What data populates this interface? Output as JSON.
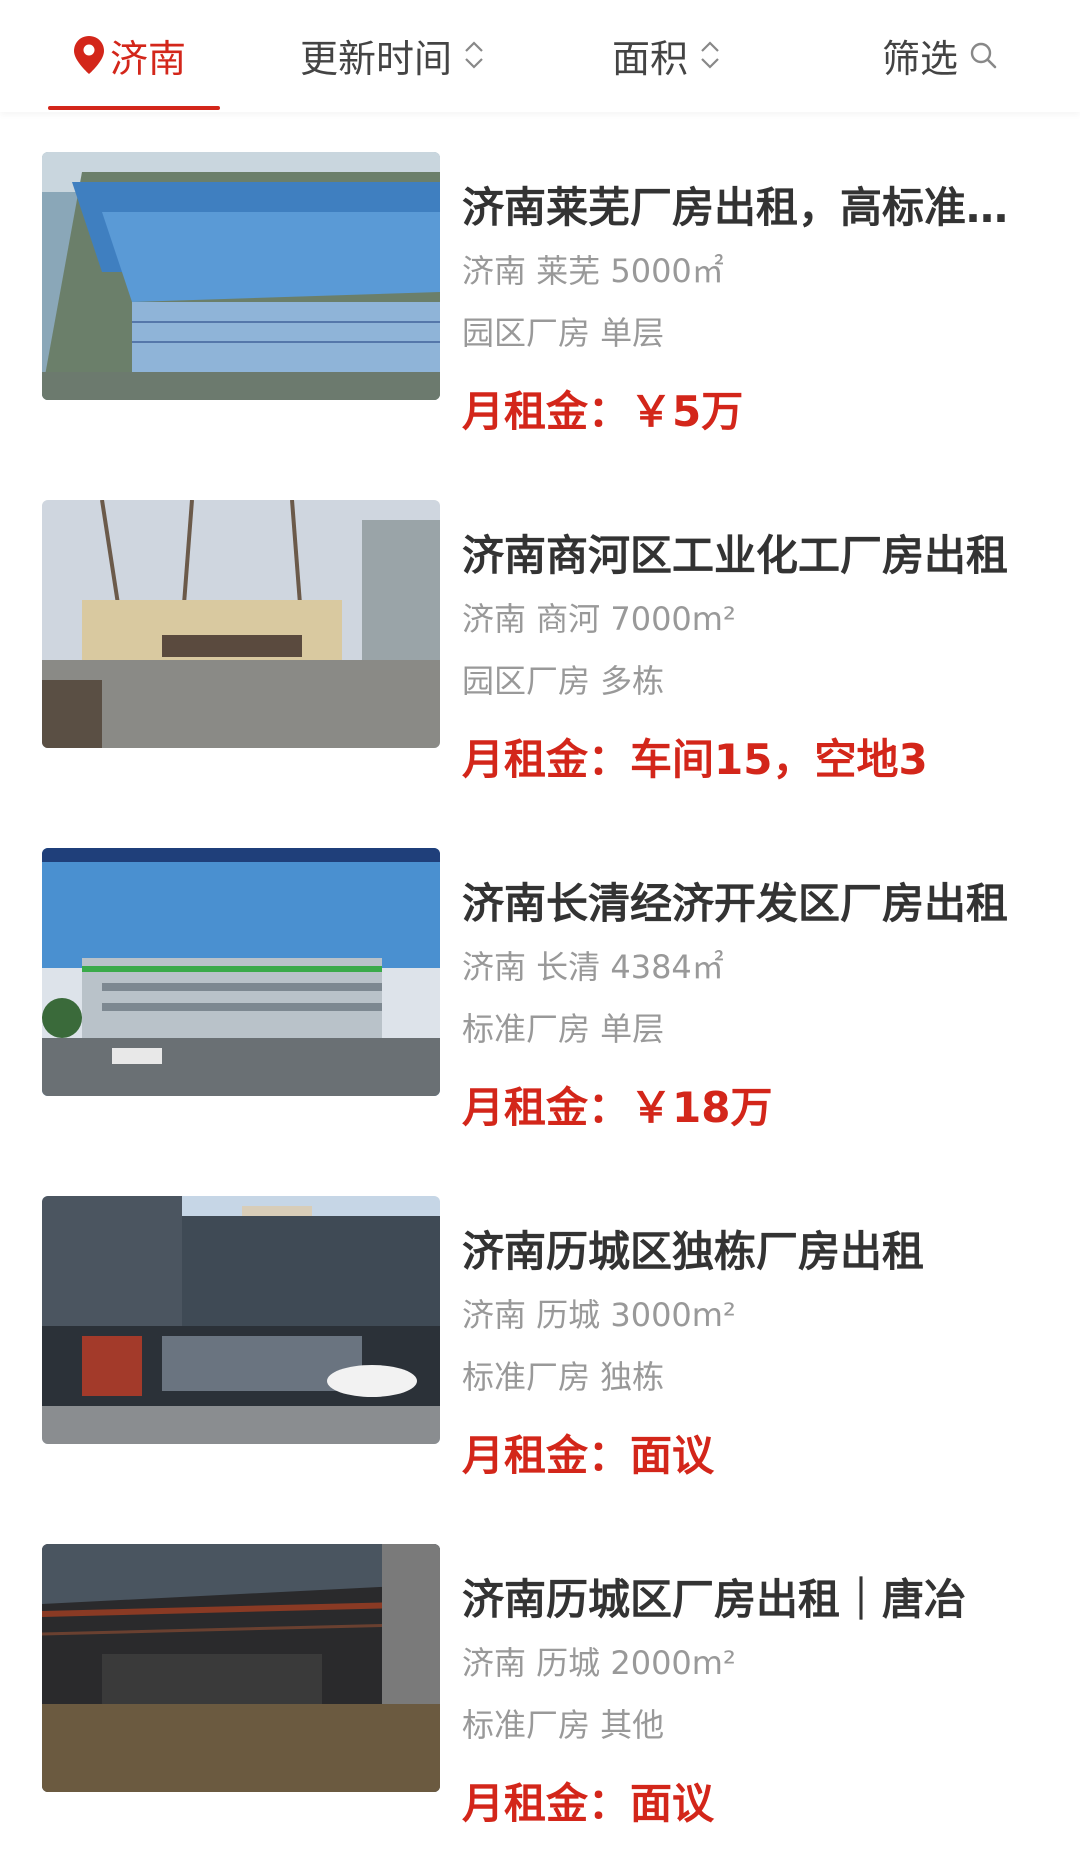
{
  "colors": {
    "accent": "#d3261a",
    "title": "#333333",
    "meta": "#999999",
    "tab": "#444444"
  },
  "filter_bar": {
    "city": {
      "label": "济南",
      "icon": "location-pin-icon"
    },
    "update_time": {
      "label": "更新时间",
      "icon": "sort-arrows-icon"
    },
    "area": {
      "label": "面积",
      "icon": "sort-arrows-icon"
    },
    "filter": {
      "label": "筛选",
      "icon": "search-icon"
    }
  },
  "listings": [
    {
      "title": "济南莱芜厂房出租，高标准厂房",
      "location": "济南 莱芜 5000㎡",
      "tags": "园区厂房 单层",
      "rent": "月租金：￥5万",
      "image": "blue-roof-factory"
    },
    {
      "title": "济南商河区工业化工厂房出租",
      "location": "济南 商河 7000m²",
      "tags": "园区厂房 多栋",
      "rent": "月租金：车间15，空地3",
      "image": "factory-gate"
    },
    {
      "title": "济南长清经济开发区厂房出租",
      "location": "济南 长清 4384㎡",
      "tags": "标准厂房 单层",
      "rent": "月租金：￥18万",
      "image": "factory-rendering"
    },
    {
      "title": "济南历城区独栋厂房出租",
      "location": "济南 历城 3000m²",
      "tags": "标准厂房 独栋",
      "rent": "月租金：面议",
      "image": "storefront-building"
    },
    {
      "title": "济南历城区厂房出租｜唐冶",
      "location": "济南 历城 2000m²",
      "tags": "标准厂房 其他",
      "rent": "月租金：面议",
      "image": "workshop-interior"
    }
  ]
}
